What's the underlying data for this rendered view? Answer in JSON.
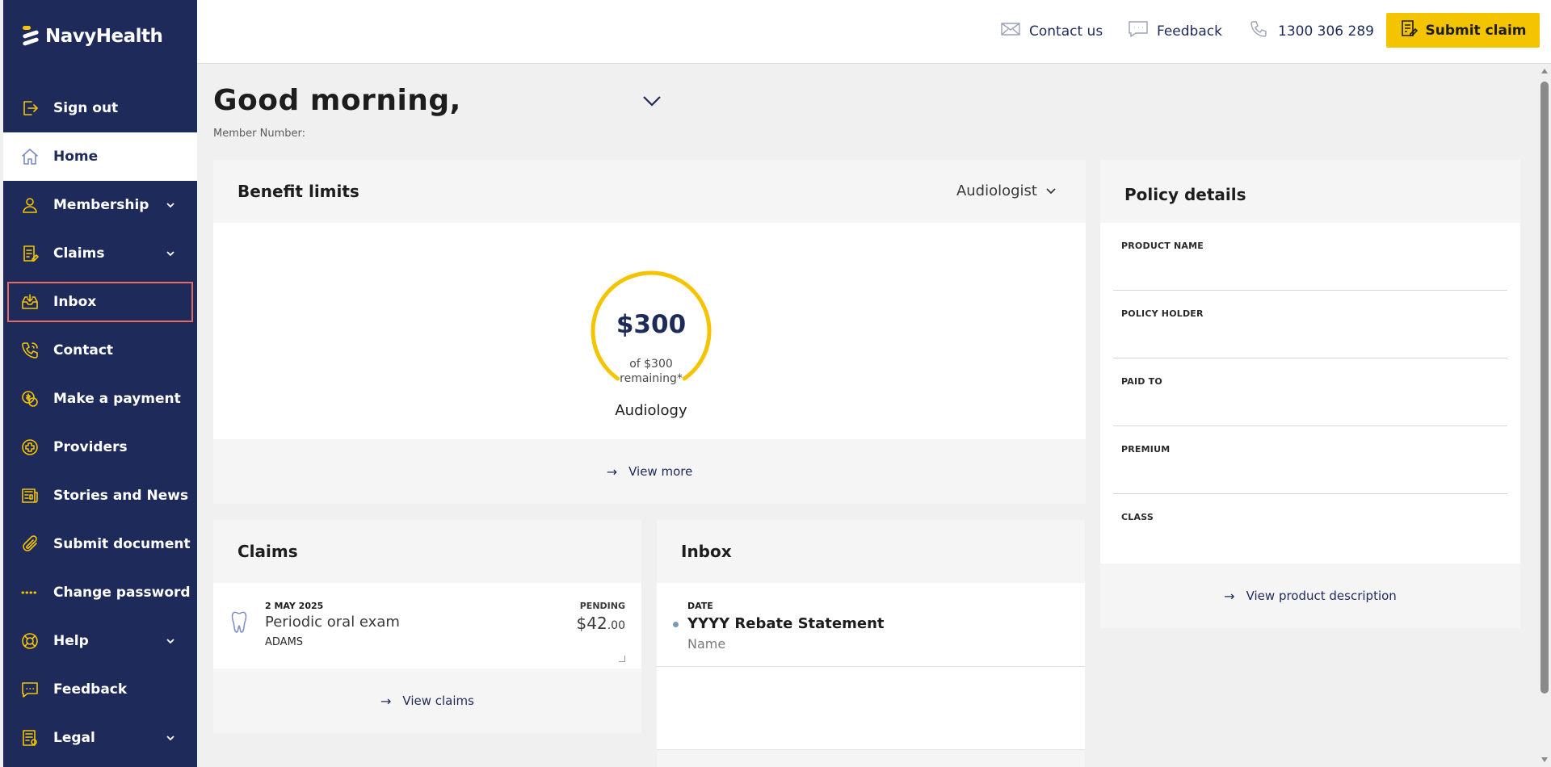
{
  "brand": {
    "name": "NavyHealth"
  },
  "sidebar": {
    "items": [
      {
        "label": "Sign out",
        "icon": "sign-out-icon"
      },
      {
        "label": "Home",
        "icon": "home-icon"
      },
      {
        "label": "Membership",
        "icon": "user-icon"
      },
      {
        "label": "Claims",
        "icon": "claims-icon"
      },
      {
        "label": "Inbox",
        "icon": "inbox-icon"
      },
      {
        "label": "Contact",
        "icon": "phone-icon"
      },
      {
        "label": "Make a payment",
        "icon": "payment-icon"
      },
      {
        "label": "Providers",
        "icon": "plus-circle-icon"
      },
      {
        "label": "Stories and News",
        "icon": "news-icon"
      },
      {
        "label": "Submit document",
        "icon": "paperclip-icon"
      },
      {
        "label": "Change password",
        "icon": "password-dots-icon"
      },
      {
        "label": "Help",
        "icon": "lifebuoy-icon"
      },
      {
        "label": "Feedback",
        "icon": "chat-icon"
      },
      {
        "label": "Legal",
        "icon": "legal-icon"
      }
    ]
  },
  "header": {
    "contact_label": "Contact us",
    "feedback_label": "Feedback",
    "phone_label": "1300 306 289",
    "submit_label": "Submit claim"
  },
  "greeting": {
    "title": "Good morning,",
    "member_label": "Member Number:"
  },
  "benefit": {
    "title": "Benefit limits",
    "selected": "Audiologist",
    "amount": "$300",
    "of_line1": "of $300",
    "of_line2": "remaining*",
    "category": "Audiology",
    "remaining_fraction": 1.0,
    "view_more": "View more"
  },
  "policy": {
    "title": "Policy details",
    "fields": [
      "PRODUCT NAME",
      "POLICY HOLDER",
      "PAID TO",
      "PREMIUM",
      "CLASS"
    ],
    "view_link": "View product description"
  },
  "claims": {
    "title": "Claims",
    "row": {
      "date": "2 MAY 2025",
      "title": "Periodic oral exam",
      "name": "ADAMS",
      "status": "PENDING",
      "amount_main": "$42",
      "amount_cents": ".00"
    },
    "view_link": "View claims"
  },
  "inbox": {
    "title": "Inbox",
    "row": {
      "date_label": "DATE",
      "title": "YYYY Rebate Statement",
      "sub": "Name"
    }
  },
  "colors": {
    "navy": "#1e2a5a",
    "yellow": "#f5c400",
    "highlight": "#e46a64"
  }
}
